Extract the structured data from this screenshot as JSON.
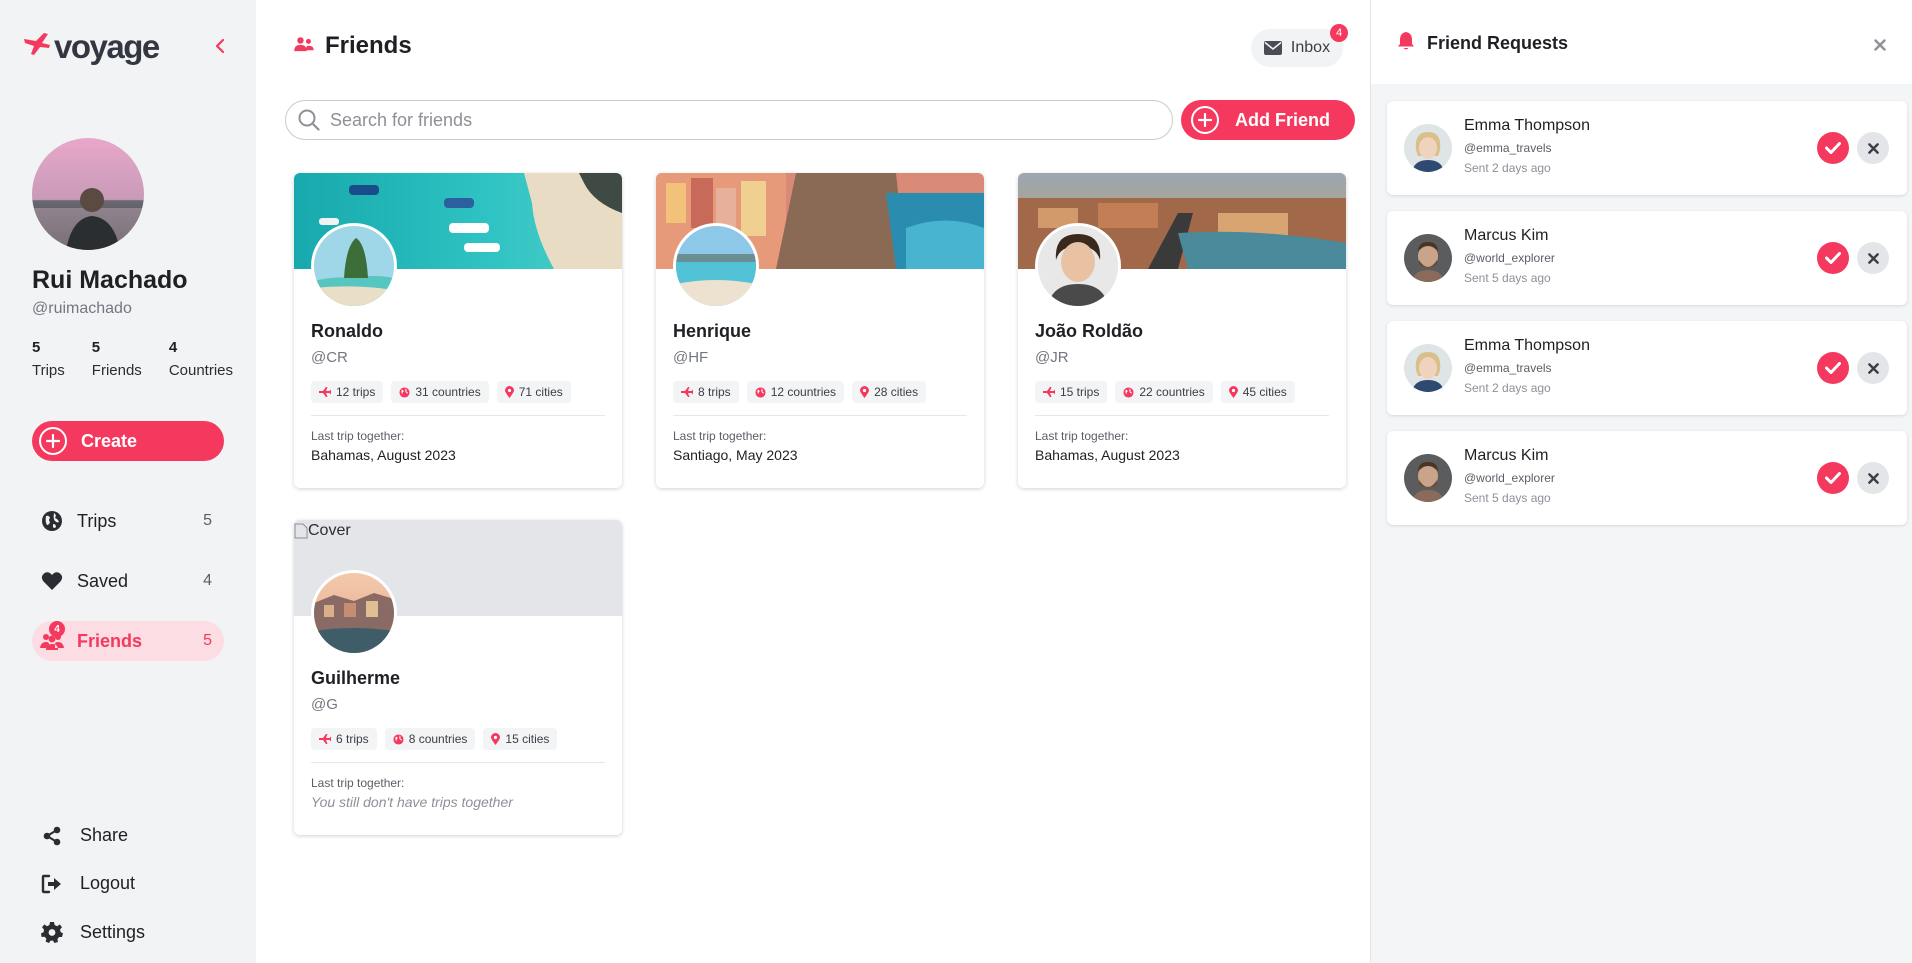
{
  "app": {
    "logo_text": "voyage",
    "accent": "#f5385d"
  },
  "profile": {
    "name": "Rui Machado",
    "handle": "@ruimachado",
    "stats": [
      {
        "value": "5",
        "label": "Trips"
      },
      {
        "value": "5",
        "label": "Friends"
      },
      {
        "value": "4",
        "label": "Countries"
      }
    ]
  },
  "sidebar": {
    "create_label": "Create",
    "nav": [
      {
        "label": "Trips",
        "count": "5",
        "icon": "globe-icon"
      },
      {
        "label": "Saved",
        "count": "4",
        "icon": "heart-icon"
      },
      {
        "label": "Friends",
        "count": "5",
        "icon": "friends-icon",
        "badge": "4",
        "active": true
      }
    ],
    "bottom": [
      {
        "label": "Share",
        "icon": "share-icon"
      },
      {
        "label": "Logout",
        "icon": "logout-icon"
      },
      {
        "label": "Settings",
        "icon": "gear-icon"
      }
    ]
  },
  "header": {
    "title": "Friends",
    "inbox_label": "Inbox",
    "inbox_badge": "4"
  },
  "search": {
    "placeholder": "Search for friends",
    "value": ""
  },
  "add_friend_label": "Add Friend",
  "friends": [
    {
      "name": "Ronaldo",
      "handle": "@CR",
      "trips": "12 trips",
      "countries": "31 countries",
      "cities": "71 cities",
      "last_label": "Last trip together:",
      "last_trip": "Bahamas, August 2023"
    },
    {
      "name": "Henrique",
      "handle": "@HF",
      "trips": "8 trips",
      "countries": "12 countries",
      "cities": "28 cities",
      "last_label": "Last trip together:",
      "last_trip": "Santiago, May 2023"
    },
    {
      "name": "João Roldão",
      "handle": "@JR",
      "trips": "15 trips",
      "countries": "22 countries",
      "cities": "45 cities",
      "last_label": "Last trip together:",
      "last_trip": "Bahamas, August 2023"
    },
    {
      "name": "Guilherme",
      "handle": "@G",
      "trips": "6 trips",
      "countries": "8 countries",
      "cities": "15 cities",
      "last_label": "Last trip together:",
      "last_trip": "You still don't have trips together",
      "cover_alt": "Cover"
    }
  ],
  "requests_panel": {
    "title": "Friend Requests",
    "requests": [
      {
        "name": "Emma Thompson",
        "handle": "@emma_travels",
        "time": "Sent 2 days ago"
      },
      {
        "name": "Marcus Kim",
        "handle": "@world_explorer",
        "time": "Sent 5 days ago"
      },
      {
        "name": "Emma Thompson",
        "handle": "@emma_travels",
        "time": "Sent 2 days ago"
      },
      {
        "name": "Marcus Kim",
        "handle": "@world_explorer",
        "time": "Sent 5 days ago"
      }
    ]
  }
}
